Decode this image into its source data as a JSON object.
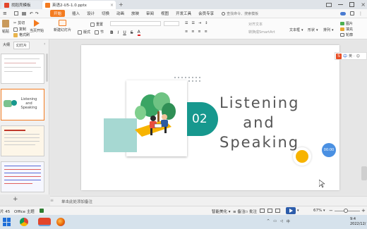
{
  "tabs": [
    {
      "label": "找稻壳模板",
      "active": false,
      "icon_color": "#e2452b"
    },
    {
      "label": "英语2-U5-1.0.pptx",
      "active": true,
      "icon_color": "#f37b20"
    }
  ],
  "menu": [
    "开始",
    "插入",
    "设计",
    "切换",
    "动画",
    "放映",
    "审阅",
    "视图",
    "开发工具",
    "会员专享"
  ],
  "search_placeholder": "查找命令、搜索模板",
  "toolbar": {
    "paste": "粘贴",
    "cut": "剪切",
    "copy": "复制",
    "format_painter": "格式刷",
    "from_current": "当页开始",
    "new_slide": "新建幻灯片",
    "layout": "版式",
    "section": "节",
    "reset": "重置",
    "textbox": "文本框",
    "shape": "形状",
    "arrange": "排列",
    "image": "图片",
    "fill": "填充",
    "outline": "轮廓",
    "align_text": "对齐文本",
    "convert_smartart": "转换成SmartArt"
  },
  "left_tabs": {
    "outline": "大纲",
    "slides": "幻灯片"
  },
  "thumb_numbers": [
    "",
    "",
    "",
    ""
  ],
  "slide": {
    "number": "02",
    "title_lines": [
      "Listening",
      "and",
      "Speaking"
    ],
    "badge_time": "00:00",
    "accent": "#17988e"
  },
  "sogou": {
    "label": "中",
    "extras": [
      "英",
      "·",
      "☺"
    ]
  },
  "notes_placeholder": "单击此处添加备注",
  "status": {
    "slide_count": "片 45",
    "theme": "Office 主题",
    "smart_beautify": "智能美化",
    "notes": "备注",
    "comments": "批注",
    "zoom": "67%"
  },
  "clock": {
    "time": "9:4",
    "date": "2022/12/"
  },
  "colors": {
    "brand_orange": "#f37b20",
    "teal": "#17988e",
    "yellow": "#f7b300"
  }
}
